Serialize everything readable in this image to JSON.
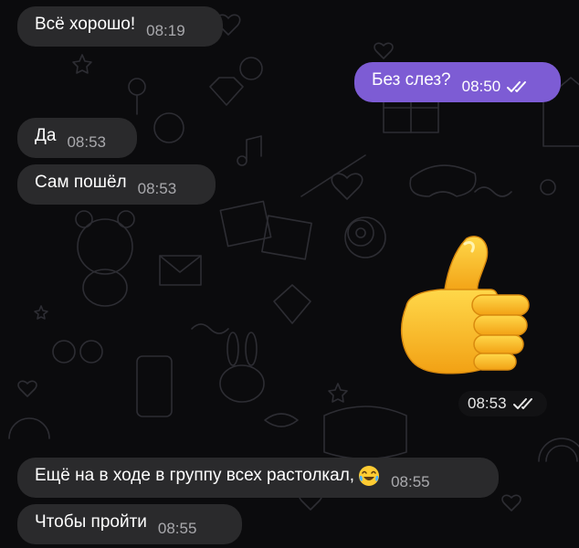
{
  "messages": [
    {
      "text": "Всё хорошо!",
      "time": "08:19"
    },
    {
      "text": "Без слез?",
      "time": "08:50"
    },
    {
      "text": "Да",
      "time": "08:53"
    },
    {
      "text": "Сам пошёл",
      "time": "08:53"
    },
    {
      "time": "08:53"
    },
    {
      "text": "Ещё на в ходе в группу всех растолкал,",
      "time": "08:55"
    },
    {
      "text": "Чтобы пройти",
      "time": "08:55"
    }
  ],
  "colors": {
    "background": "#0b0b0d",
    "incoming_bubble": "#2a2a2c",
    "outgoing_bubble": "#7d5cd4",
    "time_incoming": "#a9a9ad"
  },
  "icons": {
    "read_status": "double-check-icon",
    "sticker": "thumbs-up-emoji",
    "inline_emoji": "tears-of-joy-emoji"
  }
}
